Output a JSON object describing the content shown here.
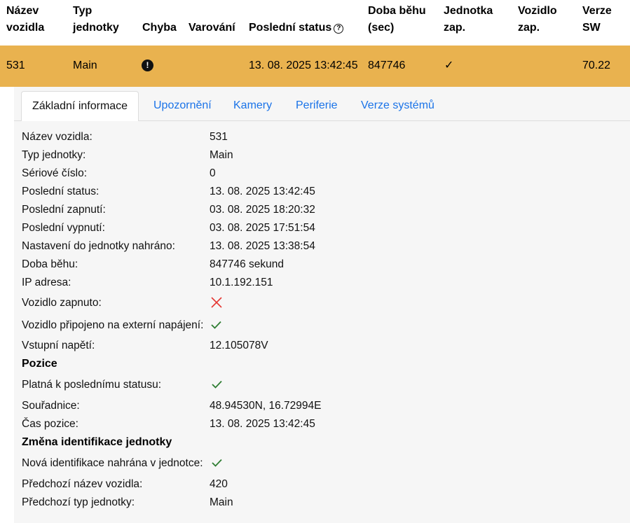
{
  "table": {
    "headers": {
      "vehicle_name": [
        "Název",
        "vozidla"
      ],
      "unit_type": [
        "Typ",
        "jednotky"
      ],
      "error": "Chyba",
      "warning": "Varování",
      "last_status": "Poslední status",
      "runtime": [
        "Doba běhu",
        "(sec)"
      ],
      "unit_on": [
        "Jednotka",
        "zap."
      ],
      "vehicle_on": [
        "Vozidlo",
        "zap."
      ],
      "sw_version": [
        "Verze",
        "SW"
      ]
    },
    "row": {
      "vehicle_name": "531",
      "unit_type": "Main",
      "error_icon": "exclamation-circle-icon",
      "last_status": "13. 08. 2025 13:42:45",
      "runtime": "847746",
      "unit_on": "✓",
      "sw_version": "70.22"
    }
  },
  "tabs": [
    "Základní informace",
    "Upozornění",
    "Kamery",
    "Periferie",
    "Verze systémů"
  ],
  "basic": {
    "vehicle_name": {
      "label": "Název vozidla:",
      "value": "531"
    },
    "unit_type": {
      "label": "Typ jednotky:",
      "value": "Main"
    },
    "serial": {
      "label": "Sériové číslo:",
      "value": "0"
    },
    "last_status": {
      "label": "Poslední status:",
      "value": "13. 08. 2025 13:42:45"
    },
    "last_on": {
      "label": "Poslední zapnutí:",
      "value": "03. 08. 2025 18:20:32"
    },
    "last_off": {
      "label": "Poslední vypnutí:",
      "value": "03. 08. 2025 17:51:54"
    },
    "config_uploaded": {
      "label": "Nastavení do jednotky nahráno:",
      "value": "13. 08. 2025 13:38:54"
    },
    "runtime": {
      "label": "Doba běhu:",
      "value": "847746 sekund"
    },
    "ip": {
      "label": "IP adresa:",
      "value": "10.1.192.151"
    },
    "vehicle_on": {
      "label": "Vozidlo zapnuto:",
      "icon": "cross-icon"
    },
    "external_power": {
      "label": "Vozidlo připojeno na externí napájení:",
      "icon": "check-icon"
    },
    "input_voltage": {
      "label": "Vstupní napětí:",
      "value": "12.105078V"
    }
  },
  "position": {
    "title": "Pozice",
    "valid": {
      "label": "Platná k poslednímu statusu:",
      "icon": "check-icon"
    },
    "coords": {
      "label": "Souřadnice:",
      "value": "48.94530N, 16.72994E"
    },
    "time": {
      "label": "Čas pozice:",
      "value": "13. 08. 2025 13:42:45"
    }
  },
  "id_change": {
    "title": "Změna identifikace jednotky",
    "uploaded": {
      "label": "Nová identifikace nahrána v jednotce:",
      "icon": "check-icon"
    },
    "prev_name": {
      "label": "Předchozí název vozidla:",
      "value": "420"
    },
    "prev_type": {
      "label": "Předchozí typ jednotky:",
      "value": "Main"
    }
  },
  "colors": {
    "row_highlight": "#e9b24f",
    "link": "#1a73e8",
    "check": "#2e7d32",
    "cross": "#e53935",
    "panel": "#f6f6f6"
  }
}
